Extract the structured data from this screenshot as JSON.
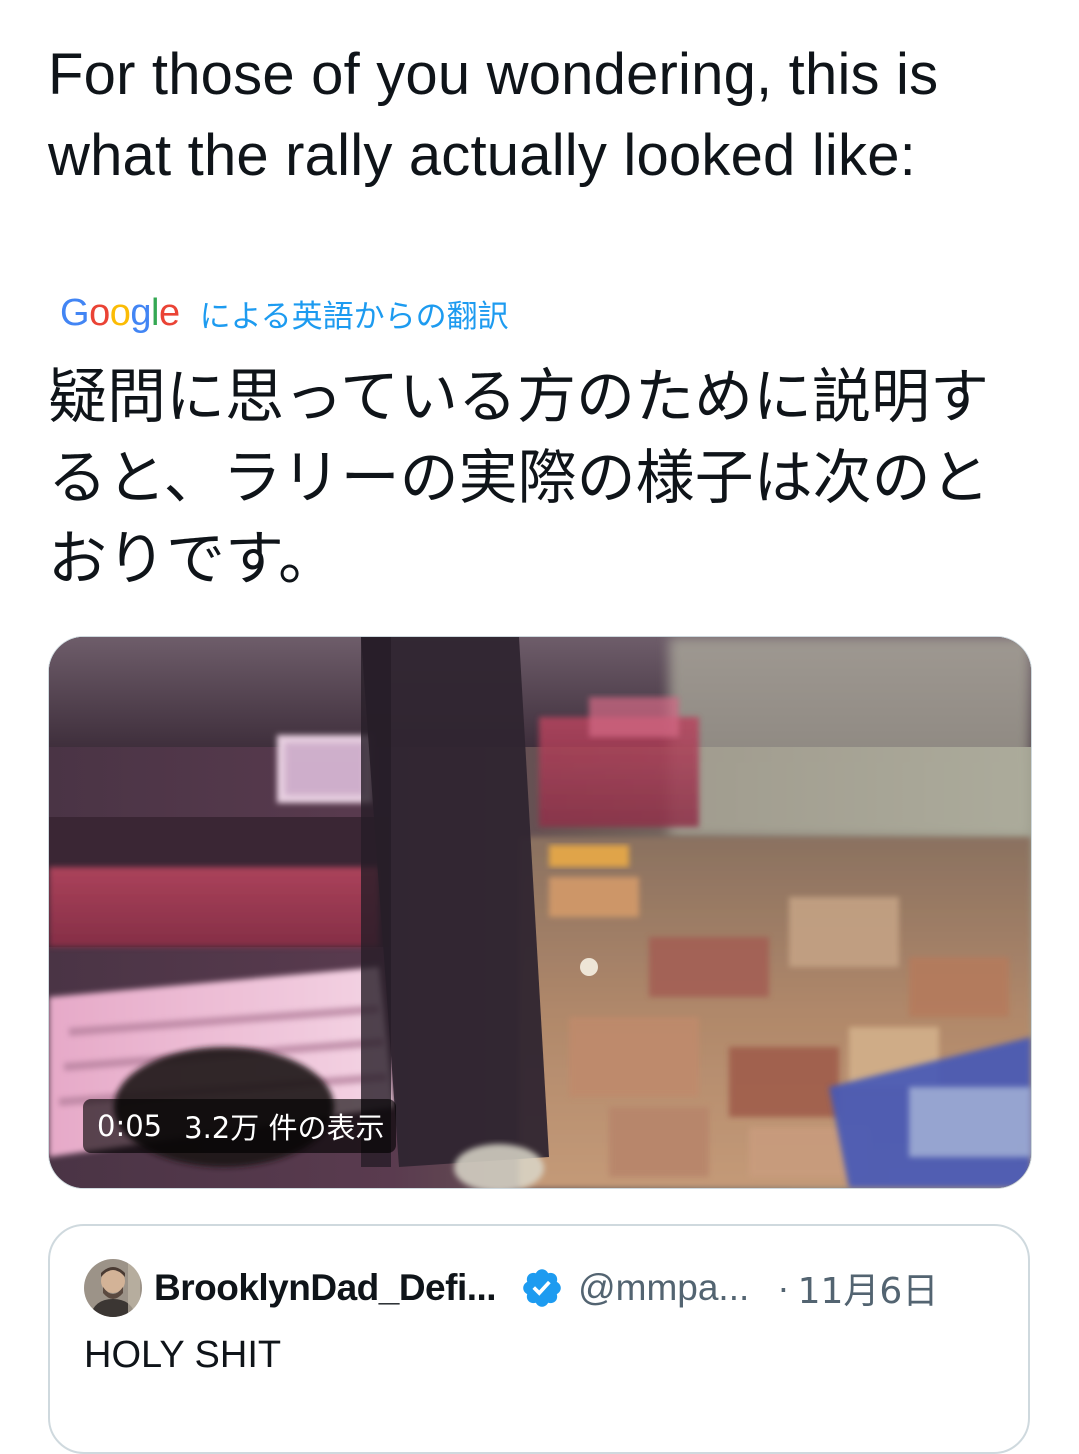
{
  "tweet": {
    "text": "For those of you wondering, this is what the rally actually looked like:"
  },
  "translation": {
    "provider": "Google",
    "label": "による英語からの翻訳",
    "text": "疑問に思っている方のために説明すると、ラリーの実際の様子は次のとおりです。",
    "google_colors": [
      "#4285F4",
      "#EA4335",
      "#FBBC05",
      "#4285F4",
      "#34A853",
      "#EA4335"
    ]
  },
  "video": {
    "duration": "0:05",
    "views": "3.2万 件の表示"
  },
  "quoted_tweet": {
    "display_name": "BrooklynDad_Defi...",
    "handle": "@mmpa...",
    "separator": "·",
    "date": "11月6日",
    "text": "HOLY SHIT",
    "verified_color": "#1d9bf0"
  },
  "icons": {
    "verified": "verified-badge-icon",
    "avatar": "avatar-image"
  }
}
